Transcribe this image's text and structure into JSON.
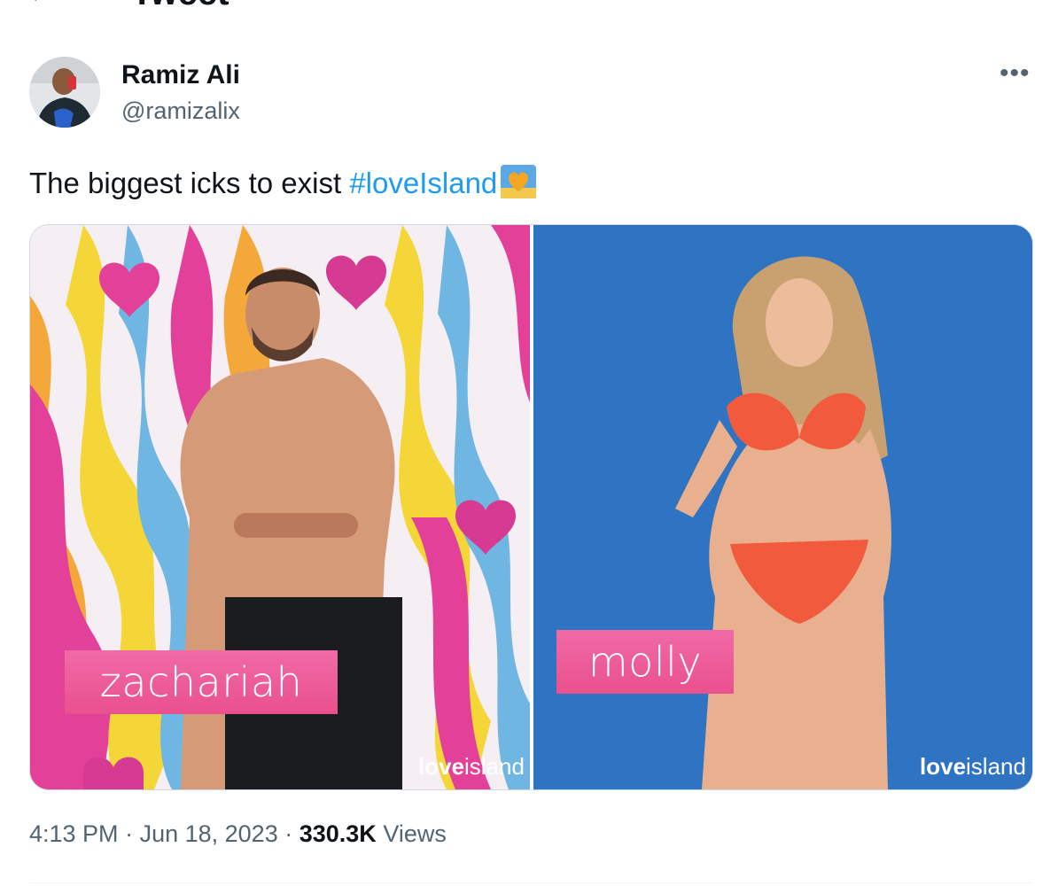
{
  "header": {
    "title": "Tweet"
  },
  "author": {
    "display_name": "Ramiz Ali",
    "handle": "@ramizalix"
  },
  "tweet": {
    "text": "The biggest icks to exist ",
    "hashtag": "#loveIsland"
  },
  "media": {
    "left": {
      "name_tag": "zachariah",
      "brand_bold": "love",
      "brand_rest": "island"
    },
    "right": {
      "name_tag": "molly",
      "brand_bold": "love",
      "brand_rest": "island"
    }
  },
  "meta": {
    "time": "4:13 PM",
    "date": "Jun 18, 2023",
    "views_count": "330.3K",
    "views_label": "Views"
  },
  "colors": {
    "hashtag": "#1d9bf0",
    "name_tag": "#ec5c99",
    "muted": "#536471"
  }
}
